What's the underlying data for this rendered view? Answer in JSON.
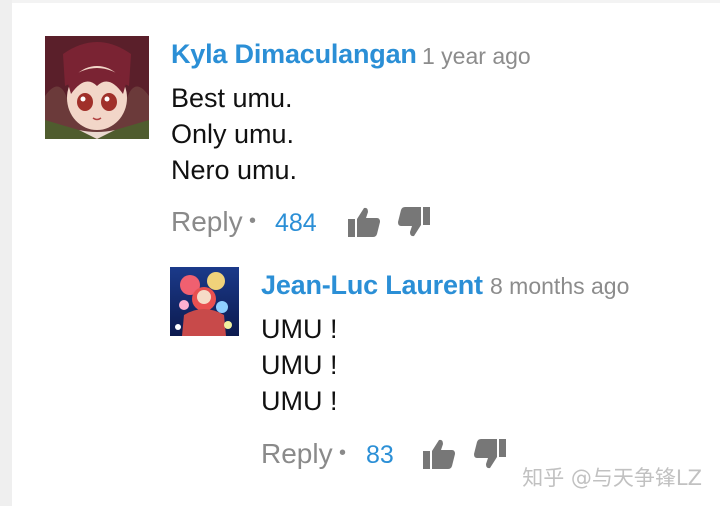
{
  "comments": [
    {
      "author": "Kyla Dimaculangan",
      "time": "1 year ago",
      "lines": [
        "Best umu.",
        "Only umu.",
        "Nero umu."
      ],
      "reply_label": "Reply",
      "separator": "•",
      "like_count": "484",
      "avatar_icon": "anime-girl-avatar"
    },
    {
      "author": "Jean-Luc Laurent",
      "time": "8 months ago",
      "lines": [
        "UMU !",
        "UMU !",
        "UMU !"
      ],
      "reply_label": "Reply",
      "separator": "•",
      "like_count": "83",
      "avatar_icon": "anime-artwork-avatar"
    }
  ],
  "watermark": "知乎 @与天争锋LZ",
  "colors": {
    "author": "#2b8fd6",
    "count": "#2b8fd6",
    "meta": "#8c8c8c",
    "icon": "#7a7a7a"
  }
}
